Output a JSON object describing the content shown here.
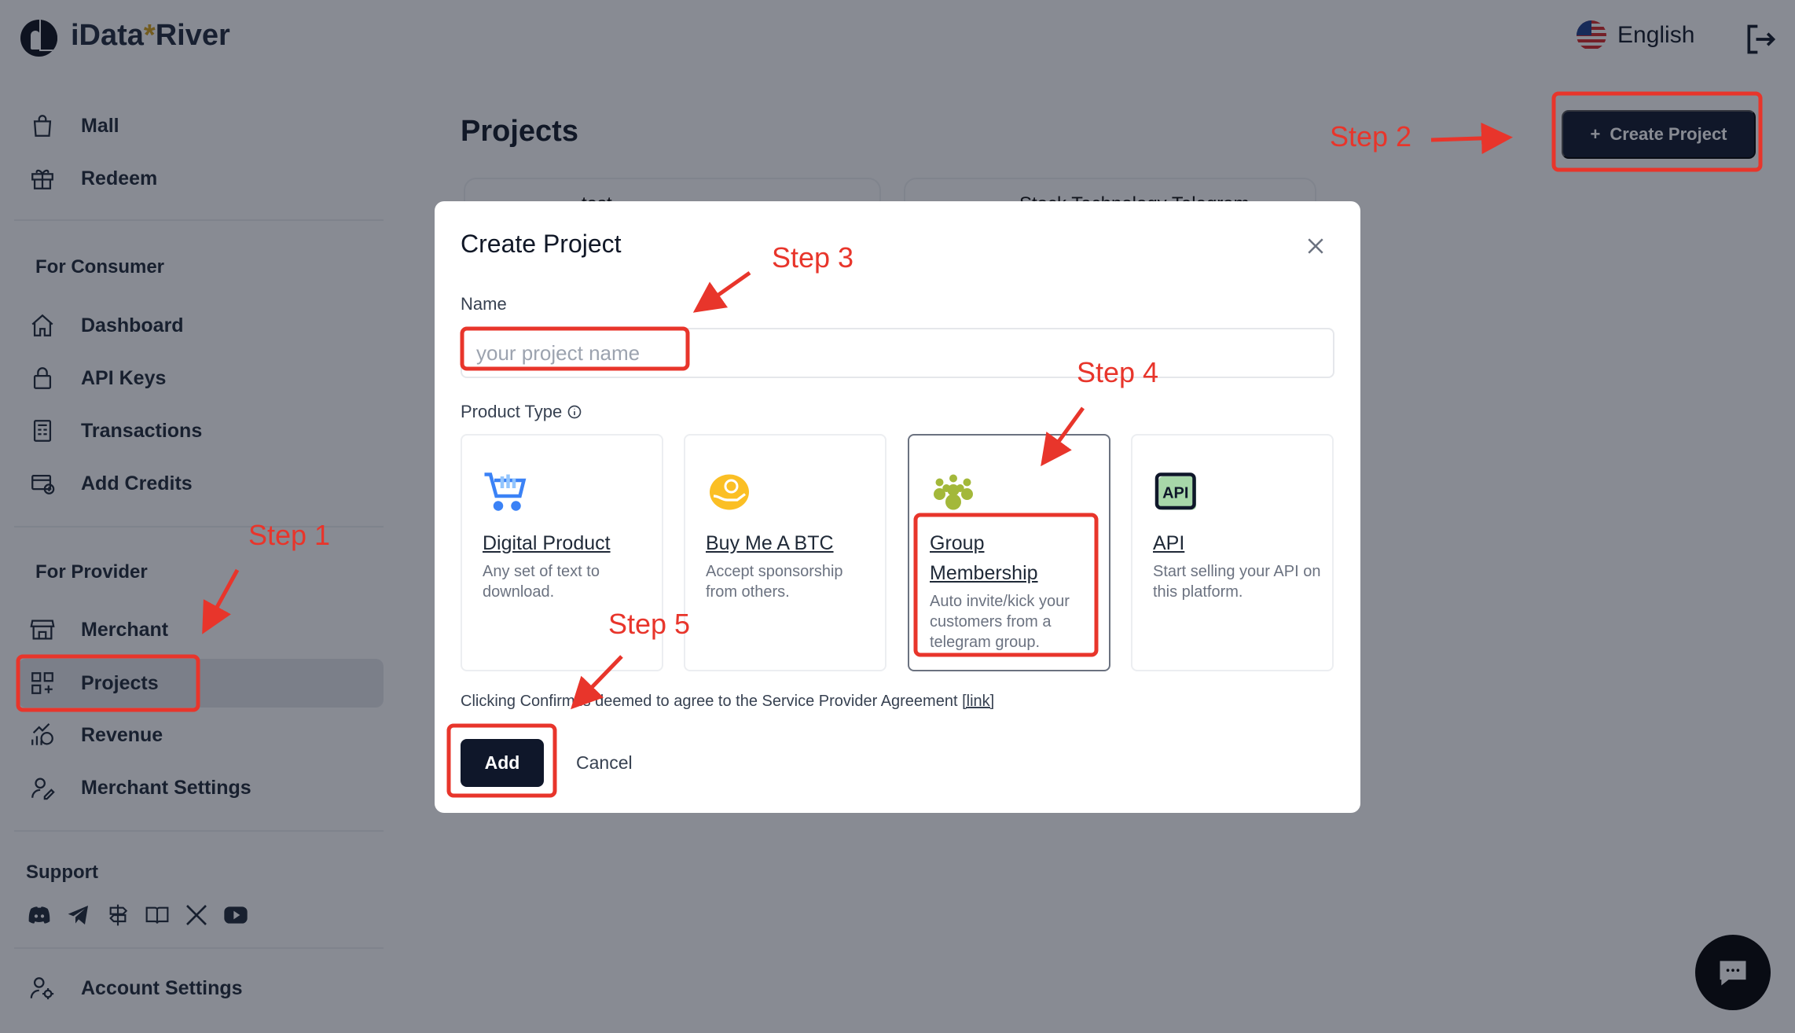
{
  "brand": {
    "name_part1": "iData",
    "star": "*",
    "name_part2": "River"
  },
  "header": {
    "language": "English",
    "language_icon": "us-flag-icon",
    "logout_icon": "logout-icon"
  },
  "sidebar": {
    "top_items": [
      {
        "label": "Mall",
        "icon": "shopping-bag-icon"
      },
      {
        "label": "Redeem",
        "icon": "gift-icon"
      }
    ],
    "consumer_heading": "For Consumer",
    "consumer_items": [
      {
        "label": "Dashboard",
        "icon": "home-icon"
      },
      {
        "label": "API Keys",
        "icon": "lock-icon"
      },
      {
        "label": "Transactions",
        "icon": "receipt-icon"
      },
      {
        "label": "Add Credits",
        "icon": "add-credit-card-icon"
      }
    ],
    "provider_heading": "For Provider",
    "provider_items": [
      {
        "label": "Merchant",
        "icon": "store-icon"
      },
      {
        "label": "Projects",
        "icon": "grid-plus-icon",
        "active": true
      },
      {
        "label": "Revenue",
        "icon": "revenue-icon"
      },
      {
        "label": "Merchant Settings",
        "icon": "merchant-settings-icon"
      }
    ],
    "support_heading": "Support",
    "support_icons": [
      "discord-icon",
      "telegram-icon",
      "signpost-icon",
      "book-icon",
      "x-icon",
      "youtube-icon"
    ],
    "account_settings": "Account Settings"
  },
  "main": {
    "title": "Projects",
    "create_button": "Create Project",
    "create_icon": "+",
    "background_projects": [
      "test",
      "Stock Technology Telegram"
    ]
  },
  "modal": {
    "title": "Create Project",
    "name_label": "Name",
    "name_placeholder": "your project name",
    "name_value": "",
    "product_type_label": "Product Type",
    "product_types": [
      {
        "title": "Digital Product",
        "desc": "Any set of text to download.",
        "icon": "shopping-cart-icon"
      },
      {
        "title": "Buy Me A BTC",
        "desc": "Accept sponsorship from others.",
        "icon": "coin-hand-icon"
      },
      {
        "title": "Group Membership",
        "desc": "Auto invite/kick your customers from a telegram group.",
        "icon": "group-icon",
        "selected": true
      },
      {
        "title": "API",
        "desc": "Start selling your API on this platform.",
        "icon": "api-icon"
      }
    ],
    "agreement_text": "Clicking Confirm is deemed to agree to the Service Provider Agreement ",
    "agreement_link": "[link]",
    "add_button": "Add",
    "cancel_button": "Cancel"
  },
  "annotations": {
    "step1": "Step 1",
    "step2": "Step 2",
    "step3": "Step 3",
    "step4": "Step 4",
    "step5": "Step 5",
    "color": "#e8352b"
  },
  "colors": {
    "primary": "#0f172a",
    "overlay": "rgba(17,24,39,0.5)",
    "accent_star": "#d4a017"
  }
}
